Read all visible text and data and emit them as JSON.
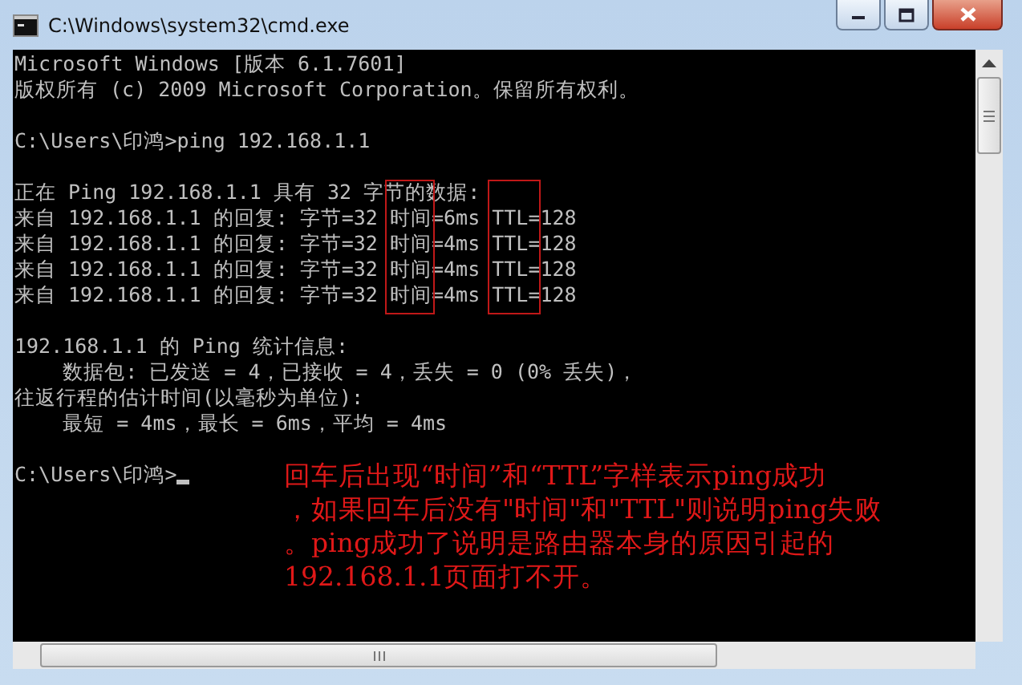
{
  "window": {
    "title": "C:\\Windows\\system32\\cmd.exe"
  },
  "console": {
    "blocks": [
      [
        "Microsoft Windows [版本 6.1.7601]",
        "版权所有 (c) 2009 Microsoft Corporation。保留所有权利。"
      ],
      [
        "C:\\Users\\印鸿>ping 192.168.1.1"
      ],
      [
        "正在 Ping 192.168.1.1 具有 32 字节的数据:",
        "来自 192.168.1.1 的回复: 字节=32 时间=6ms TTL=128",
        "来自 192.168.1.1 的回复: 字节=32 时间=4ms TTL=128",
        "来自 192.168.1.1 的回复: 字节=32 时间=4ms TTL=128",
        "来自 192.168.1.1 的回复: 字节=32 时间=4ms TTL=128"
      ],
      [
        "192.168.1.1 的 Ping 统计信息:",
        "    数据包: 已发送 = 4，已接收 = 4，丢失 = 0 (0% 丢失)，",
        "往返行程的估计时间(以毫秒为单位):",
        "    最短 = 4ms，最长 = 6ms，平均 = 4ms"
      ],
      [
        "C:\\Users\\印鸿>"
      ]
    ]
  },
  "annotation": {
    "lines": [
      "回车后出现“时间”和“TTL”字样表示ping成功",
      "，如果回车后没有\"时间\"和\"TTL\"则说明ping失败",
      "。ping成功了说明是路由器本身的原因引起的",
      "192.168.1.1页面打不开。"
    ]
  }
}
